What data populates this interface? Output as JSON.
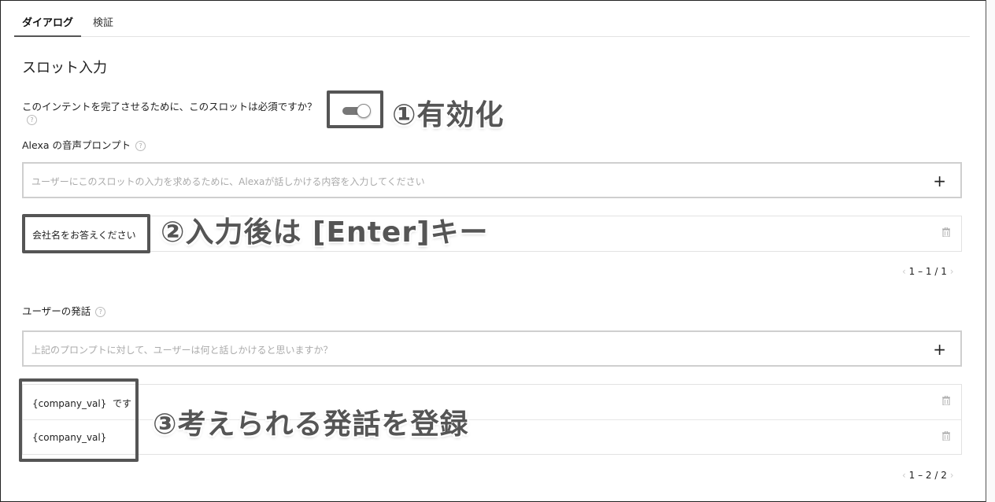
{
  "tabs": [
    {
      "label": "ダイアログ"
    },
    {
      "label": "検証"
    }
  ],
  "section_title": "スロット入力",
  "required": {
    "label": "このインテントを完了させるために、このスロットは必須ですか？",
    "help": "?"
  },
  "voice_prompt": {
    "label": "Alexa の音声プロンプト",
    "help": "?",
    "placeholder": "ユーザーにこのスロットの入力を求めるために、Alexaが話しかける内容を入力してください",
    "add": "+",
    "items": [
      {
        "text": "会社名をお答えください"
      }
    ],
    "pager": "1 – 1 / 1"
  },
  "utterances": {
    "label": "ユーザーの発話",
    "help": "?",
    "placeholder": "上記のプロンプトに対して、ユーザーは何と話しかけると思いますか？",
    "add": "+",
    "items": [
      {
        "text": "{company_val}  です"
      },
      {
        "text": "{company_val}"
      }
    ],
    "pager": "1 – 2 / 2"
  },
  "annotations": {
    "a1": "①有効化",
    "a2": "②入力後は [Enter]キー",
    "a3": "③考えられる発話を登録"
  },
  "colors": {
    "highlight_border": "#555555",
    "annotation_text": "#555555",
    "toggle_on": "#777777"
  }
}
